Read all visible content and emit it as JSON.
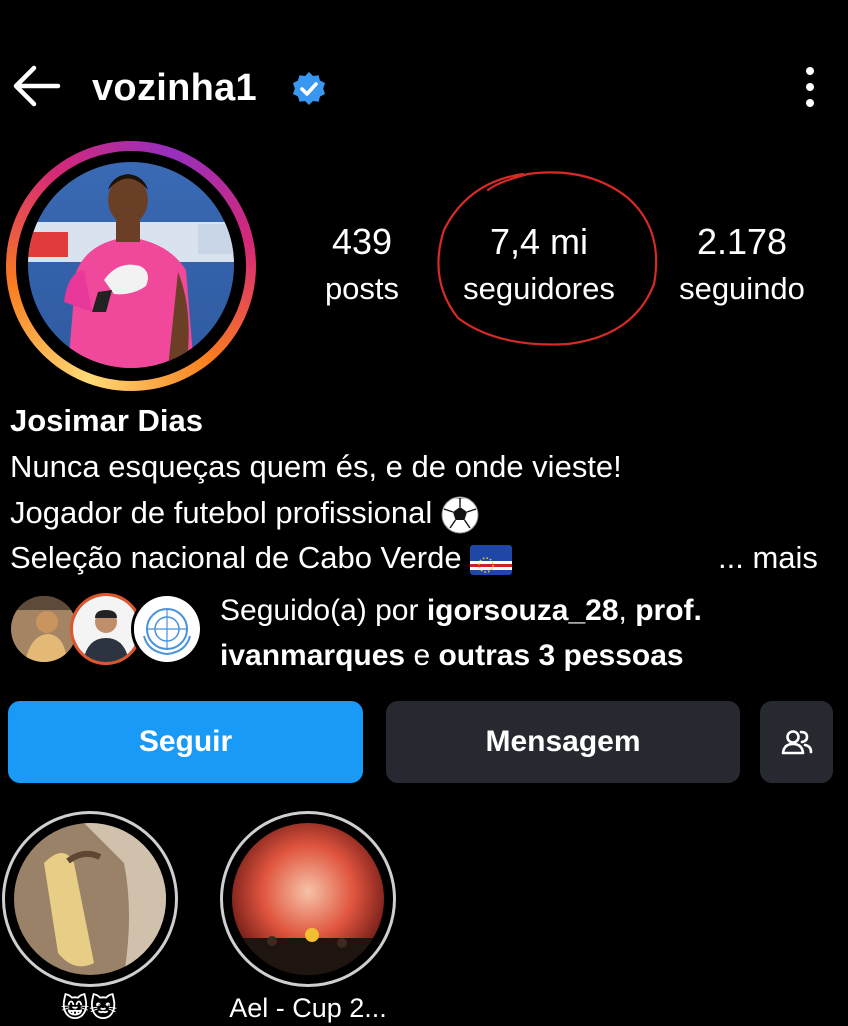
{
  "header": {
    "username": "vozinha1",
    "icons": {
      "back": "back-arrow-icon",
      "verified": "verified-badge-icon",
      "more": "more-vertical-icon"
    }
  },
  "stats": {
    "posts": {
      "value": "439",
      "label": "posts"
    },
    "followers": {
      "value": "7,4 mi",
      "label": "seguidores"
    },
    "following": {
      "value": "2.178",
      "label": "seguindo"
    }
  },
  "profile": {
    "name": "Josimar Dias",
    "bio": [
      "Nunca esqueças quem és, e de onde vieste!",
      "Jogador de futebol profissional",
      "Seleção nacional de Cabo Verde"
    ],
    "bio_icons": [
      "soccer-ball-icon",
      "cape-verde-flag-icon"
    ],
    "more_label": "... mais"
  },
  "followed_by": {
    "prefix": "Seguido(a) por",
    "user1": "igorsouza_28",
    "separator": ",",
    "user2": "prof. ivanmarques",
    "connector": "e",
    "others": "outras 3 pessoas"
  },
  "actions": {
    "follow_label": "Seguir",
    "message_label": "Mensagem",
    "suggest_icon": "add-people-icon"
  },
  "highlights": [
    {
      "label": "😸🐱"
    },
    {
      "label": "Ael - Cup 2..."
    }
  ],
  "colors": {
    "background": "#000000",
    "follow_button": "#1a9af7",
    "secondary_button": "#262a30",
    "verified": "#3897f0",
    "annotation_circle": "#d42b25"
  }
}
